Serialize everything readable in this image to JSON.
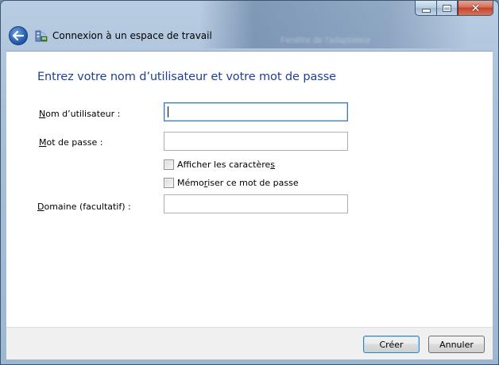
{
  "window": {
    "title": "Connexion à un espace de travail",
    "background_blur_texts": [
      "",
      "Fenêtre de l'adaptateur"
    ]
  },
  "caption_buttons": {
    "minimize_icon": "minimize-icon",
    "maximize_icon": "maximize-icon",
    "close_icon": "close-icon"
  },
  "header": {
    "back_icon": "back-arrow-icon",
    "app_icon": "workspace-connection-icon",
    "title": "Connexion à un espace de travail"
  },
  "form": {
    "heading": "Entrez votre nom d’utilisateur et votre mot de passe",
    "username": {
      "label_accel": "N",
      "label_rest": "om d’utilisateur :",
      "value": ""
    },
    "password": {
      "label_accel": "M",
      "label_rest": "ot de passe :",
      "value": ""
    },
    "show_chars": {
      "label_pre": "Afficher les caractère",
      "label_accel": "s",
      "label_post": "",
      "checked": false
    },
    "remember": {
      "label_pre": "Mémo",
      "label_accel": "r",
      "label_post": "iser ce mot de passe",
      "checked": false
    },
    "domain": {
      "label_accel": "D",
      "label_rest": "omaine (facultatif) :",
      "value": ""
    }
  },
  "footer": {
    "create_label": "Créer",
    "cancel_label": "Annuler"
  },
  "colors": {
    "heading": "#1e3f9a",
    "default_button_border": "#3c7fb1",
    "close_button": "#c2442a"
  }
}
